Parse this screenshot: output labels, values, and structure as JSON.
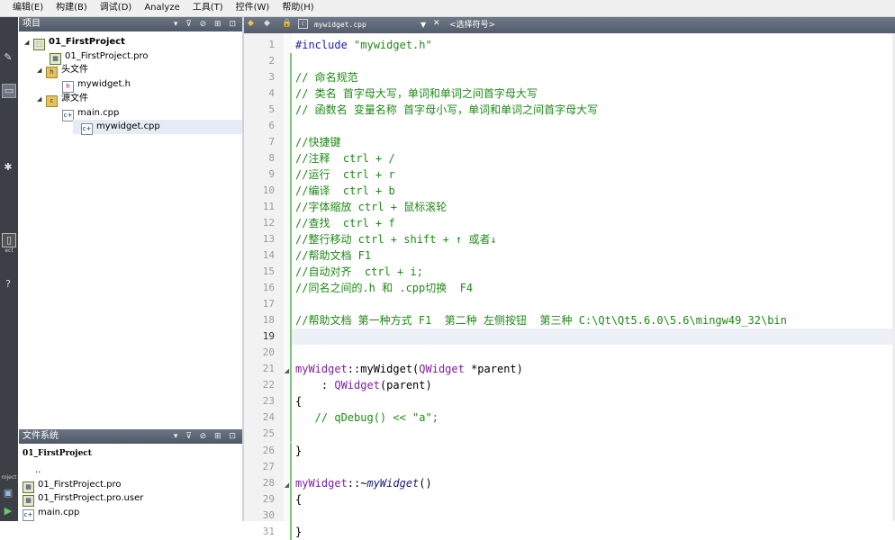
{
  "menubar": [
    "编辑(E)",
    "构建(B)",
    "调试(D)",
    "Analyze",
    "工具(T)",
    "控件(W)",
    "帮助(H)"
  ],
  "leftbar": {
    "label_top": "ect",
    "label_bottom": "roject"
  },
  "project_panel": {
    "title": "项目",
    "tools": "▾ ⊽ ⊘ ⊞ ⊡",
    "tree": [
      {
        "label": "01_FirstProject",
        "bold": true
      },
      {
        "label": "01_FirstProject.pro"
      },
      {
        "label": "头文件"
      },
      {
        "label": "mywidget.h"
      },
      {
        "label": "源文件"
      },
      {
        "label": "main.cpp"
      },
      {
        "label": "mywidget.cpp",
        "selected": true
      }
    ]
  },
  "fs_panel": {
    "title": "文件系统",
    "tools": "▾ ⊽ ⊘ ⊞ ⊡",
    "path": "01_FirstProject",
    "items": [
      "..",
      "01_FirstProject.pro",
      "01_FirstProject.pro.user",
      "main.cpp"
    ]
  },
  "editor": {
    "file_name": "mywidget.cpp",
    "symbol_placeholder": "<选择符号>",
    "current_line": 19,
    "lines": [
      {
        "n": 1,
        "parts": [
          [
            "pre",
            "#include "
          ],
          [
            "str",
            "\"mywidget.h\""
          ]
        ]
      },
      {
        "n": 2,
        "parts": []
      },
      {
        "n": 3,
        "parts": [
          [
            "com",
            "// 命名规范"
          ]
        ]
      },
      {
        "n": 4,
        "parts": [
          [
            "com",
            "// 类名 首字母大写，单词和单词之间首字母大写"
          ]
        ]
      },
      {
        "n": 5,
        "parts": [
          [
            "com",
            "// 函数名 变量名称 首字母小写，单词和单词之间首字母大写"
          ]
        ]
      },
      {
        "n": 6,
        "parts": []
      },
      {
        "n": 7,
        "parts": [
          [
            "com",
            "//快捷键"
          ]
        ]
      },
      {
        "n": 8,
        "parts": [
          [
            "com",
            "//注释  ctrl + /"
          ]
        ]
      },
      {
        "n": 9,
        "parts": [
          [
            "com",
            "//运行  ctrl + r"
          ]
        ]
      },
      {
        "n": 10,
        "parts": [
          [
            "com",
            "//编译  ctrl + b"
          ]
        ]
      },
      {
        "n": 11,
        "parts": [
          [
            "com",
            "//字体缩放 ctrl + 鼠标滚轮"
          ]
        ]
      },
      {
        "n": 12,
        "parts": [
          [
            "com",
            "//查找  ctrl + f"
          ]
        ]
      },
      {
        "n": 13,
        "parts": [
          [
            "com",
            "//整行移动 ctrl + shift + ↑ 或者↓"
          ]
        ]
      },
      {
        "n": 14,
        "parts": [
          [
            "com",
            "//帮助文档 F1"
          ]
        ]
      },
      {
        "n": 15,
        "parts": [
          [
            "com",
            "//自动对齐  ctrl + i;"
          ]
        ]
      },
      {
        "n": 16,
        "parts": [
          [
            "com",
            "//同名之间的.h 和 .cpp切换  F4"
          ]
        ]
      },
      {
        "n": 17,
        "parts": []
      },
      {
        "n": 18,
        "parts": [
          [
            "com",
            "//帮助文档 第一种方式 F1  第二种 左侧按钮  第三种 C:\\Qt\\Qt5.6.0\\5.6\\mingw49_32\\bin"
          ]
        ]
      },
      {
        "n": 19,
        "parts": []
      },
      {
        "n": 20,
        "parts": []
      },
      {
        "n": 21,
        "parts": [
          [
            "type",
            "myWidget"
          ],
          [
            "plain",
            "::myWidget("
          ],
          [
            "type",
            "QWidget"
          ],
          [
            "plain",
            " *parent)"
          ]
        ]
      },
      {
        "n": 22,
        "parts": [
          [
            "plain",
            "    : "
          ],
          [
            "type",
            "QWidget"
          ],
          [
            "plain",
            "(parent)"
          ]
        ]
      },
      {
        "n": 23,
        "parts": [
          [
            "plain",
            "{"
          ]
        ]
      },
      {
        "n": 24,
        "parts": [
          [
            "com",
            "   // qDebug() << \"a\";"
          ]
        ]
      },
      {
        "n": 25,
        "parts": []
      },
      {
        "n": 26,
        "parts": [
          [
            "plain",
            "}"
          ]
        ]
      },
      {
        "n": 27,
        "parts": []
      },
      {
        "n": 28,
        "parts": [
          [
            "type",
            "myWidget"
          ],
          [
            "plain",
            "::~"
          ],
          [
            "ital",
            "myWidget"
          ],
          [
            "plain",
            "()"
          ]
        ]
      },
      {
        "n": 29,
        "parts": [
          [
            "plain",
            "{"
          ]
        ]
      },
      {
        "n": 30,
        "parts": []
      },
      {
        "n": 31,
        "parts": [
          [
            "plain",
            "}"
          ]
        ]
      }
    ]
  }
}
